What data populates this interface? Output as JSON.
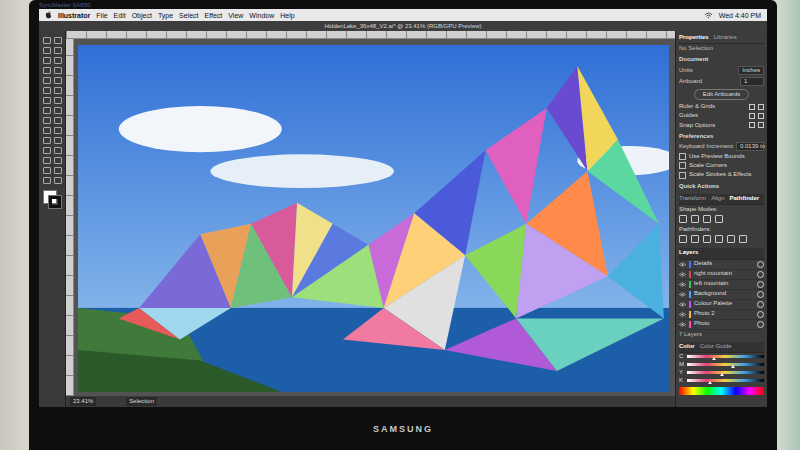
{
  "monitor": {
    "model": "SyncMaster SA850",
    "brand": "SAMSUNG"
  },
  "menu_bar": {
    "items": [
      "Illustrator",
      "File",
      "Edit",
      "Object",
      "Type",
      "Select",
      "Effect",
      "View",
      "Window",
      "Help"
    ],
    "clock": "Wed 4:40 PM"
  },
  "document": {
    "tab_title": "HiddenLake_36x48_V2.ai* @ 23.41% (RGB/GPU Preview)"
  },
  "status_bar": {
    "zoom": "23.41%",
    "tool": "Selection"
  },
  "properties": {
    "tabs": [
      {
        "label": "Properties",
        "selected": true
      },
      {
        "label": "Libraries",
        "selected": false
      }
    ],
    "selection": "No Selection",
    "section": "Document",
    "fields": [
      {
        "label": "Units",
        "value": "Inches"
      },
      {
        "label": "Artboard",
        "value": "1"
      }
    ],
    "edit_button": "Edit Artboards",
    "rows": [
      "Ruler & Grids",
      "Guides",
      "Snap Options"
    ],
    "preferences": "Preferences",
    "increment": {
      "label": "Keyboard Increment",
      "value": "0.0139 in"
    },
    "checks": [
      {
        "label": "Use Preview Bounds",
        "checked": false
      },
      {
        "label": "Scale Corners",
        "checked": false
      },
      {
        "label": "Scale Strokes & Effects",
        "checked": false
      }
    ],
    "quick_actions": "Quick Actions"
  },
  "pathfinder": {
    "tabs": [
      {
        "label": "Transform",
        "selected": false
      },
      {
        "label": "Align",
        "selected": false
      },
      {
        "label": "Pathfinder",
        "selected": true
      }
    ],
    "shape_modes": "Shape Modes:",
    "pathfinders": "Pathfinders:"
  },
  "layers": {
    "title": "Layers",
    "items": [
      {
        "name": "Details",
        "visible": true,
        "color": "#4f6cff"
      },
      {
        "name": "right mountain",
        "visible": true,
        "color": "#e04848"
      },
      {
        "name": "left mountain",
        "visible": true,
        "color": "#3fbf5a"
      },
      {
        "name": "Background",
        "visible": true,
        "color": "#4f9cff"
      },
      {
        "name": "Colour Palette",
        "visible": true,
        "color": "#c04fff"
      },
      {
        "name": "Photo 2",
        "visible": true,
        "color": "#ffb04f"
      },
      {
        "name": "Photo",
        "visible": true,
        "color": "#ff4fa8"
      }
    ],
    "count": "7 Layers"
  },
  "color_panel": {
    "tabs": [
      {
        "label": "Color",
        "selected": true
      },
      {
        "label": "Color Guide",
        "selected": false
      }
    ],
    "sliders": [
      {
        "label": "C",
        "level": 0.35
      },
      {
        "label": "M",
        "level": 0.6
      },
      {
        "label": "Y",
        "level": 0.45
      },
      {
        "label": "K",
        "level": 0.3
      }
    ]
  }
}
